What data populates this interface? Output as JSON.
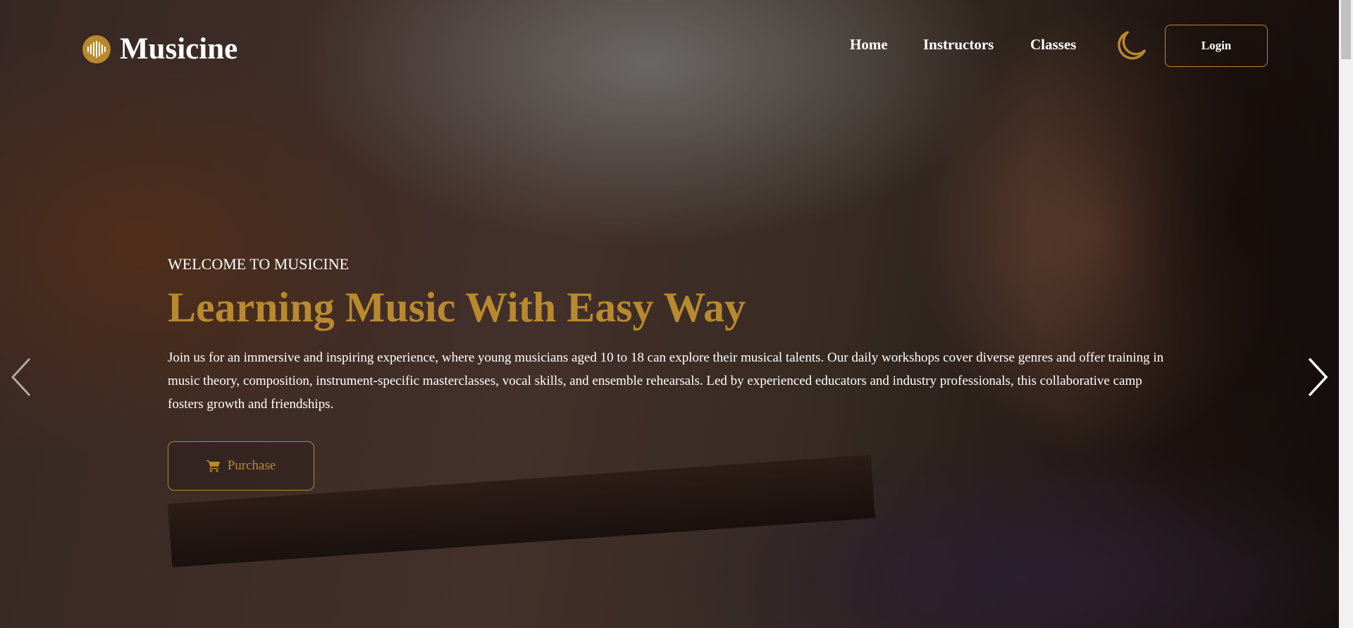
{
  "brand": {
    "name": "Musicine",
    "accent": "#b8892f"
  },
  "nav": {
    "items": [
      "Home",
      "Instructors",
      "Classes"
    ],
    "theme_icon": "moon-icon",
    "login": "Login"
  },
  "hero": {
    "eyebrow": "WELCOME TO MUSICINE",
    "title": "Learning Music With Easy Way",
    "description": "Join us for an immersive and inspiring experience, where young musicians aged 10 to 18 can explore their musical talents. Our daily workshops cover diverse genres and offer training in music theory, composition, instrument-specific masterclasses, vocal skills, and ensemble rehearsals. Led by experienced educators and industry professionals, this collaborative camp fosters growth and friendships.",
    "button": "Purchase",
    "button_icon": "cart-icon"
  },
  "carousel": {
    "prev_icon": "chevron-left-icon",
    "next_icon": "chevron-right-icon"
  }
}
